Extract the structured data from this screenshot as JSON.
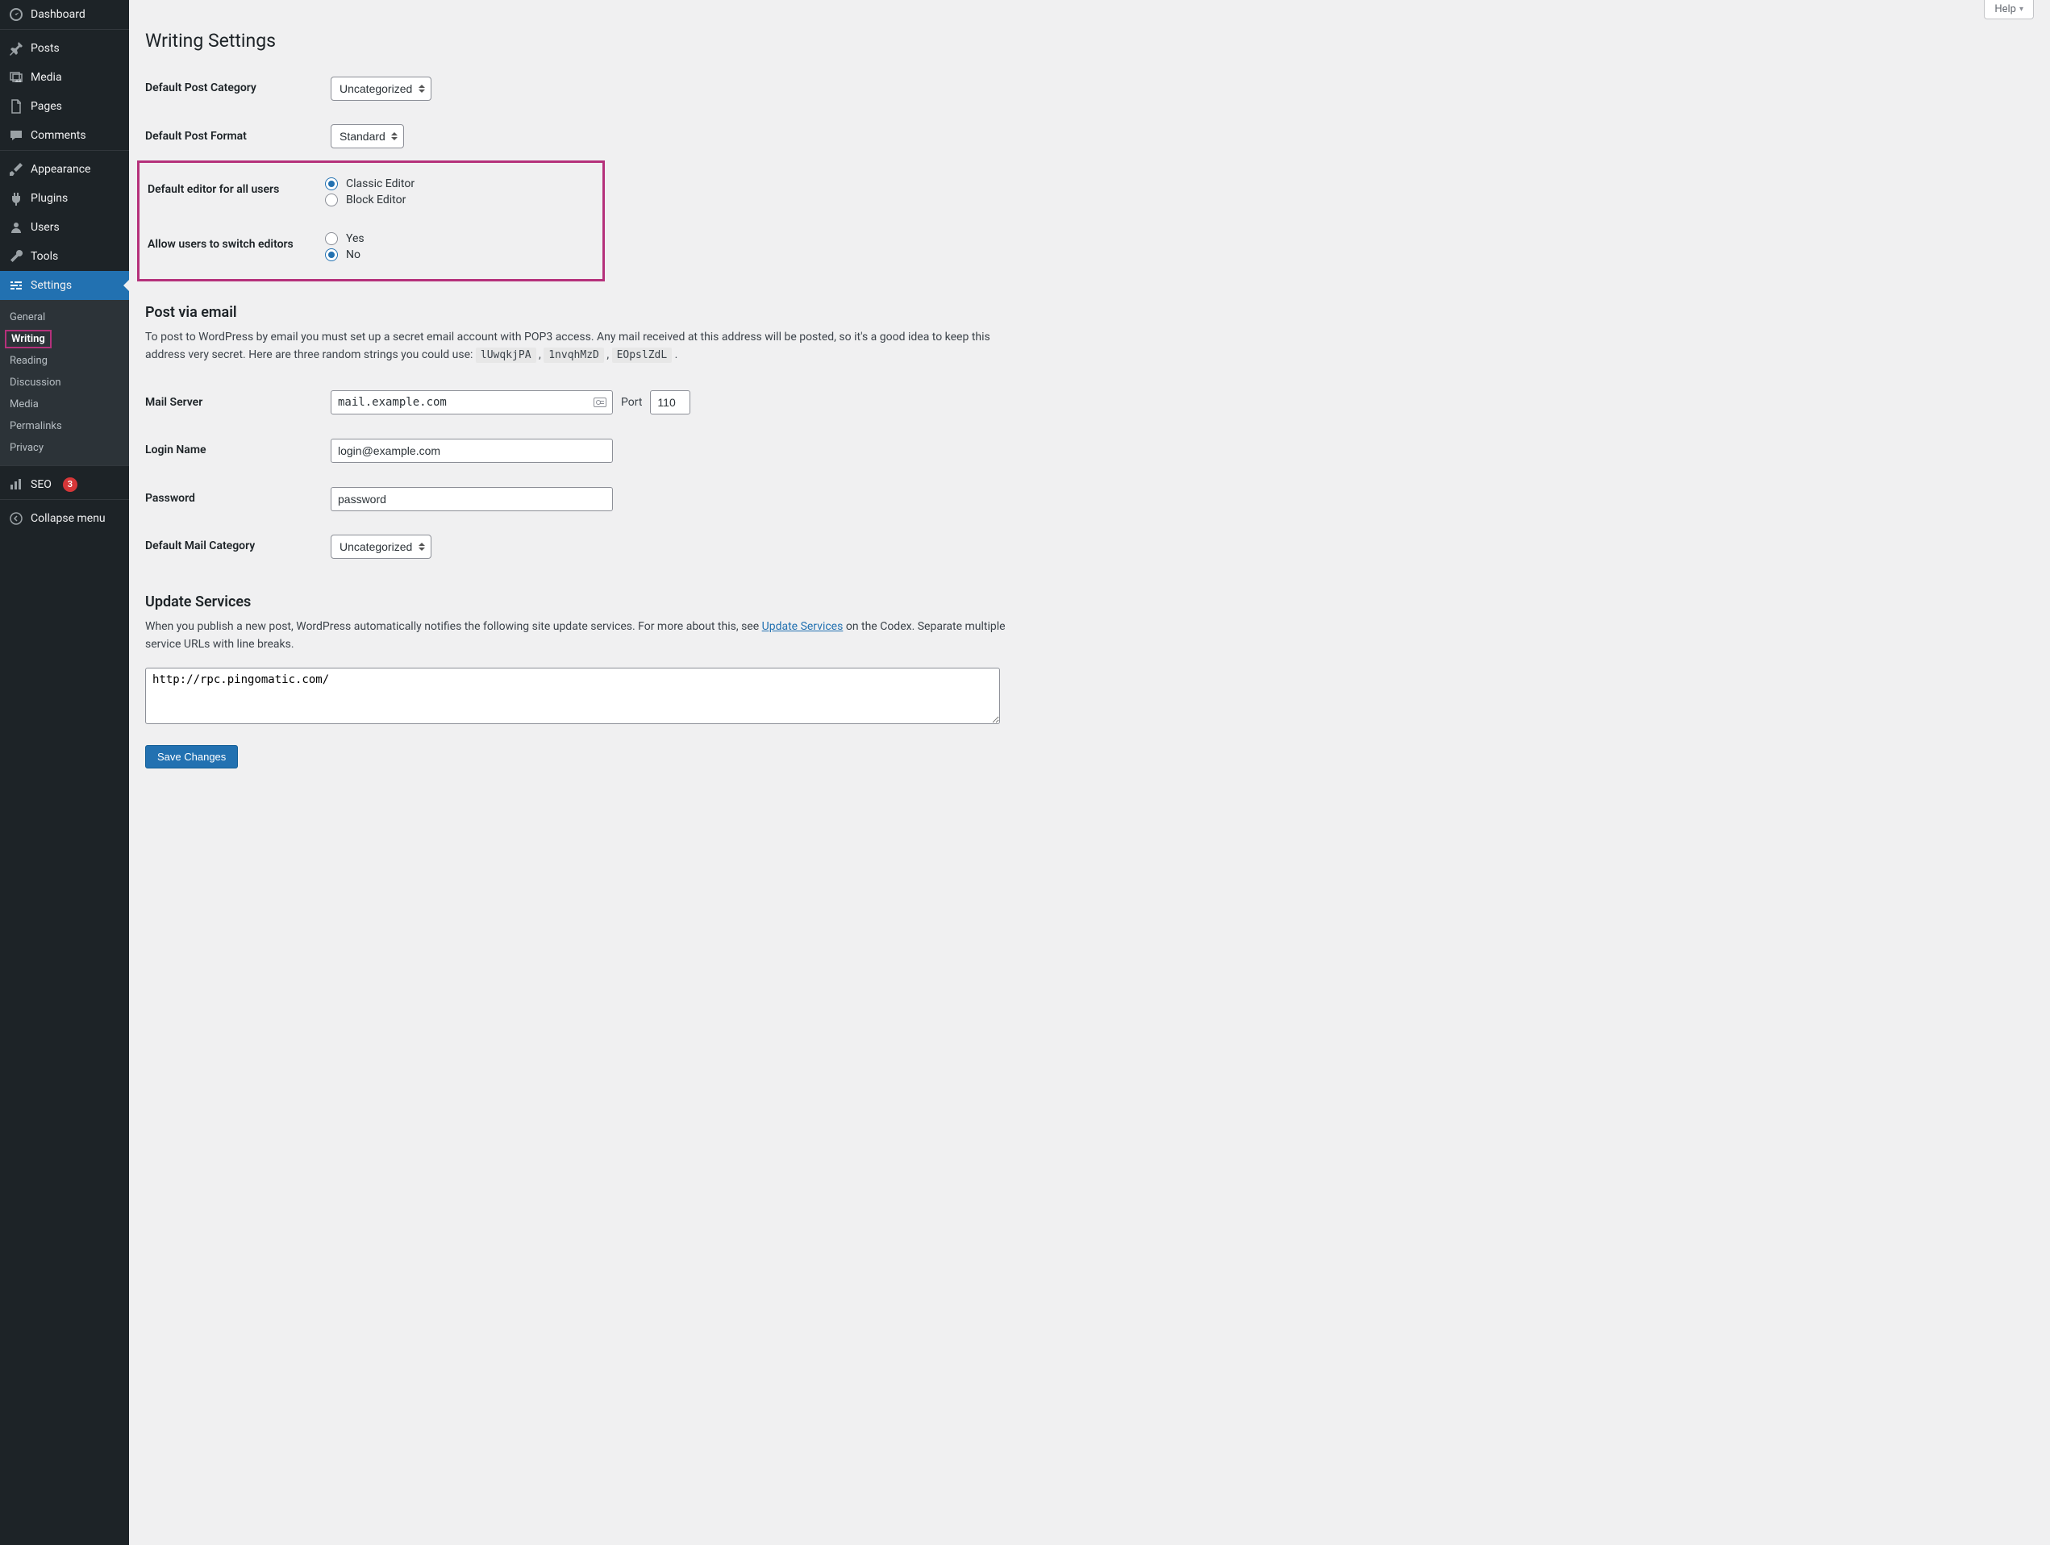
{
  "help_label": "Help",
  "page_title": "Writing Settings",
  "sidebar": {
    "dashboard": "Dashboard",
    "posts": "Posts",
    "media": "Media",
    "pages": "Pages",
    "comments": "Comments",
    "appearance": "Appearance",
    "plugins": "Plugins",
    "users": "Users",
    "tools": "Tools",
    "settings": "Settings",
    "seo": "SEO",
    "seo_badge": "3",
    "collapse": "Collapse menu",
    "sub": {
      "general": "General",
      "writing": "Writing",
      "reading": "Reading",
      "discussion": "Discussion",
      "media": "Media",
      "permalinks": "Permalinks",
      "privacy": "Privacy"
    }
  },
  "rows": {
    "default_category_label": "Default Post Category",
    "default_category_value": "Uncategorized",
    "default_format_label": "Default Post Format",
    "default_format_value": "Standard",
    "default_editor_label": "Default editor for all users",
    "default_editor_opt_classic": "Classic Editor",
    "default_editor_opt_block": "Block Editor",
    "allow_switch_label": "Allow users to switch editors",
    "allow_switch_yes": "Yes",
    "allow_switch_no": "No",
    "mail_server_label": "Mail Server",
    "mail_server_value": "mail.example.com",
    "port_label": "Port",
    "port_value": "110",
    "login_label": "Login Name",
    "login_value": "login@example.com",
    "password_label": "Password",
    "password_value": "password",
    "mail_category_label": "Default Mail Category",
    "mail_category_value": "Uncategorized"
  },
  "post_via_email": {
    "heading": "Post via email",
    "intro_pre": "To post to WordPress by email you must set up a secret email account with POP3 access. Any mail received at this address will be posted, so it's a good idea to keep this address very secret. Here are three random strings you could use: ",
    "s1": "lUwqkjPA",
    "s2": "1nvqhMzD",
    "s3": "EOpslZdL",
    "trail": " ."
  },
  "update_services": {
    "heading": "Update Services",
    "pre": "When you publish a new post, WordPress automatically notifies the following site update services. For more about this, see ",
    "link": "Update Services",
    "post": " on the Codex. Separate multiple service URLs with line breaks.",
    "textarea": "http://rpc.pingomatic.com/"
  },
  "save_button": "Save Changes"
}
